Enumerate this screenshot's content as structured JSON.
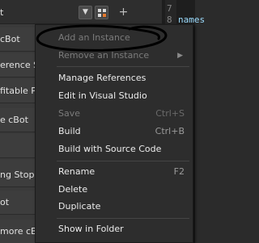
{
  "toolbar": {
    "partial_label": "t",
    "dropdown_icon": "chevron-down-icon",
    "dropdown_glyph": "▼",
    "instances_icon": "instances-icon",
    "add_icon": "plus-icon",
    "add_glyph": "+"
  },
  "left_list": {
    "items": [
      {
        "label": "cBot"
      },
      {
        "label": "erence S"
      },
      {
        "label": "fitable Po"
      },
      {
        "label": "e cBot"
      },
      {
        "label": ""
      },
      {
        "label": ""
      },
      {
        "label": "ng Stop"
      },
      {
        "label": "ot"
      },
      {
        "label": "more cB"
      }
    ]
  },
  "editor": {
    "line_number": "7",
    "line_number_2": "8",
    "code_fragment": "names"
  },
  "context_menu": {
    "items": {
      "add_instance": {
        "label": "Add an Instance",
        "enabled": false
      },
      "remove_instance": {
        "label": "Remove an Instance",
        "enabled": false,
        "submenu_arrow": "▶"
      },
      "manage_references": {
        "label": "Manage References"
      },
      "edit_visual_studio": {
        "label": "Edit in Visual Studio"
      },
      "save": {
        "label": "Save",
        "shortcut": "Ctrl+S",
        "enabled": false
      },
      "build": {
        "label": "Build",
        "shortcut": "Ctrl+B"
      },
      "build_source": {
        "label": "Build with Source Code"
      },
      "rename": {
        "label": "Rename",
        "shortcut": "F2"
      },
      "delete": {
        "label": "Delete"
      },
      "duplicate": {
        "label": "Duplicate"
      },
      "show_in_folder": {
        "label": "Show in Folder"
      }
    }
  },
  "colors": {
    "menu_bg": "#2d2d2d",
    "disabled_text": "#7b7b7b",
    "enabled_text": "#ececec",
    "accent_orange": "#e67a2e"
  }
}
